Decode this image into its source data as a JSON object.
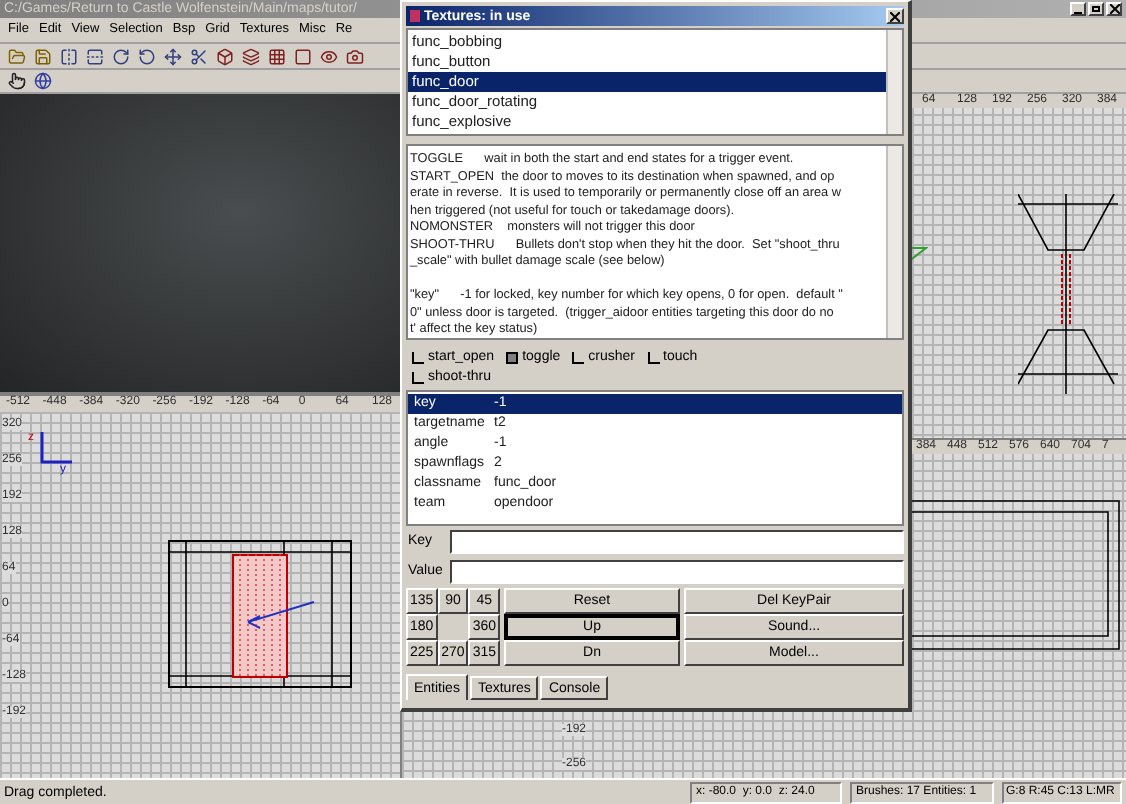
{
  "window": {
    "title": "C:/Games/Return to Castle Wolfenstein/Main/maps/tutor/"
  },
  "menu": [
    "File",
    "Edit",
    "View",
    "Selection",
    "Bsp",
    "Grid",
    "Textures",
    "Misc",
    "Re"
  ],
  "xy_view": {
    "axis_labels": [
      "z",
      "y"
    ],
    "top_ruler": [
      "-512",
      "-448",
      "-384",
      "-320",
      "-256",
      "-192",
      "-128",
      "-64",
      "0",
      "64",
      "128"
    ],
    "left_ruler": [
      "320",
      "256",
      "192",
      "128",
      "64",
      "0",
      "-64",
      "-128",
      "-192"
    ]
  },
  "top_view": {
    "top_ruler": [
      "64",
      "128",
      "192",
      "256",
      "320",
      "384"
    ]
  },
  "side_view": {
    "top_ruler": [
      "384",
      "448",
      "512",
      "576",
      "640",
      "704",
      "7"
    ],
    "left_ruler": [
      "-192",
      "-256"
    ]
  },
  "dialog": {
    "title": "Textures: in use",
    "classes": [
      {
        "label": "func_bobbing",
        "selected": false
      },
      {
        "label": "func_button",
        "selected": false
      },
      {
        "label": "func_door",
        "selected": true
      },
      {
        "label": "func_door_rotating",
        "selected": false
      },
      {
        "label": "func_explosive",
        "selected": false
      }
    ],
    "description": [
      "TOGGLE      wait in both the start and end states for a trigger event.",
      "START_OPEN  the door to moves to its destination when spawned, and op",
      "erate in reverse.  It is used to temporarily or permanently close off an area w",
      "hen triggered (not useful for touch or takedamage doors).",
      "NOMONSTER    monsters will not trigger this door",
      "SHOOT-THRU      Bullets don't stop when they hit the door.  Set \"shoot_thru",
      "_scale\" with bullet damage scale (see below)",
      "\"key\"      -1 for locked, key number for which key opens, 0 for open.  default \"",
      "0\" unless door is targeted.  (trigger_aidoor entities targeting this door do no",
      "t' affect the key status)"
    ],
    "flags": [
      {
        "label": "start_open",
        "checked": false
      },
      {
        "label": "toggle",
        "checked": true
      },
      {
        "label": "crusher",
        "checked": false
      },
      {
        "label": "touch",
        "checked": false
      },
      {
        "label": "shoot-thru",
        "checked": false
      }
    ],
    "properties": [
      {
        "key": "key",
        "value": "-1",
        "selected": true
      },
      {
        "key": "targetname",
        "value": "t2",
        "selected": false
      },
      {
        "key": "angle",
        "value": "-1",
        "selected": false
      },
      {
        "key": "spawnflags",
        "value": "2",
        "selected": false
      },
      {
        "key": "classname",
        "value": "func_door",
        "selected": false
      },
      {
        "key": "team",
        "value": "opendoor",
        "selected": false
      }
    ],
    "key_label": "Key",
    "value_label": "Value",
    "angles": [
      "135",
      "90",
      "45",
      "180",
      "360",
      "225",
      "270",
      "315"
    ],
    "buttons": [
      [
        {
          "label": "Reset",
          "focused": false
        },
        {
          "label": "Up",
          "focused": true
        },
        {
          "label": "Dn",
          "focused": false
        }
      ],
      [
        {
          "label": "Del KeyPair",
          "focused": false
        },
        {
          "label": "Sound...",
          "focused": false
        },
        {
          "label": "Model...",
          "focused": false
        }
      ]
    ],
    "tabs": [
      {
        "label": "Entities",
        "selected": true
      },
      {
        "label": "Textures",
        "selected": false
      },
      {
        "label": "Console",
        "selected": false
      }
    ]
  },
  "status_bar": {
    "message": "Drag completed.",
    "coords": "x: -80.0  y: 0.0  z: 24.0",
    "counts": "Brushes: 17 Entities: 1",
    "grid": "G:8 R:45 C:13 L:MR"
  }
}
